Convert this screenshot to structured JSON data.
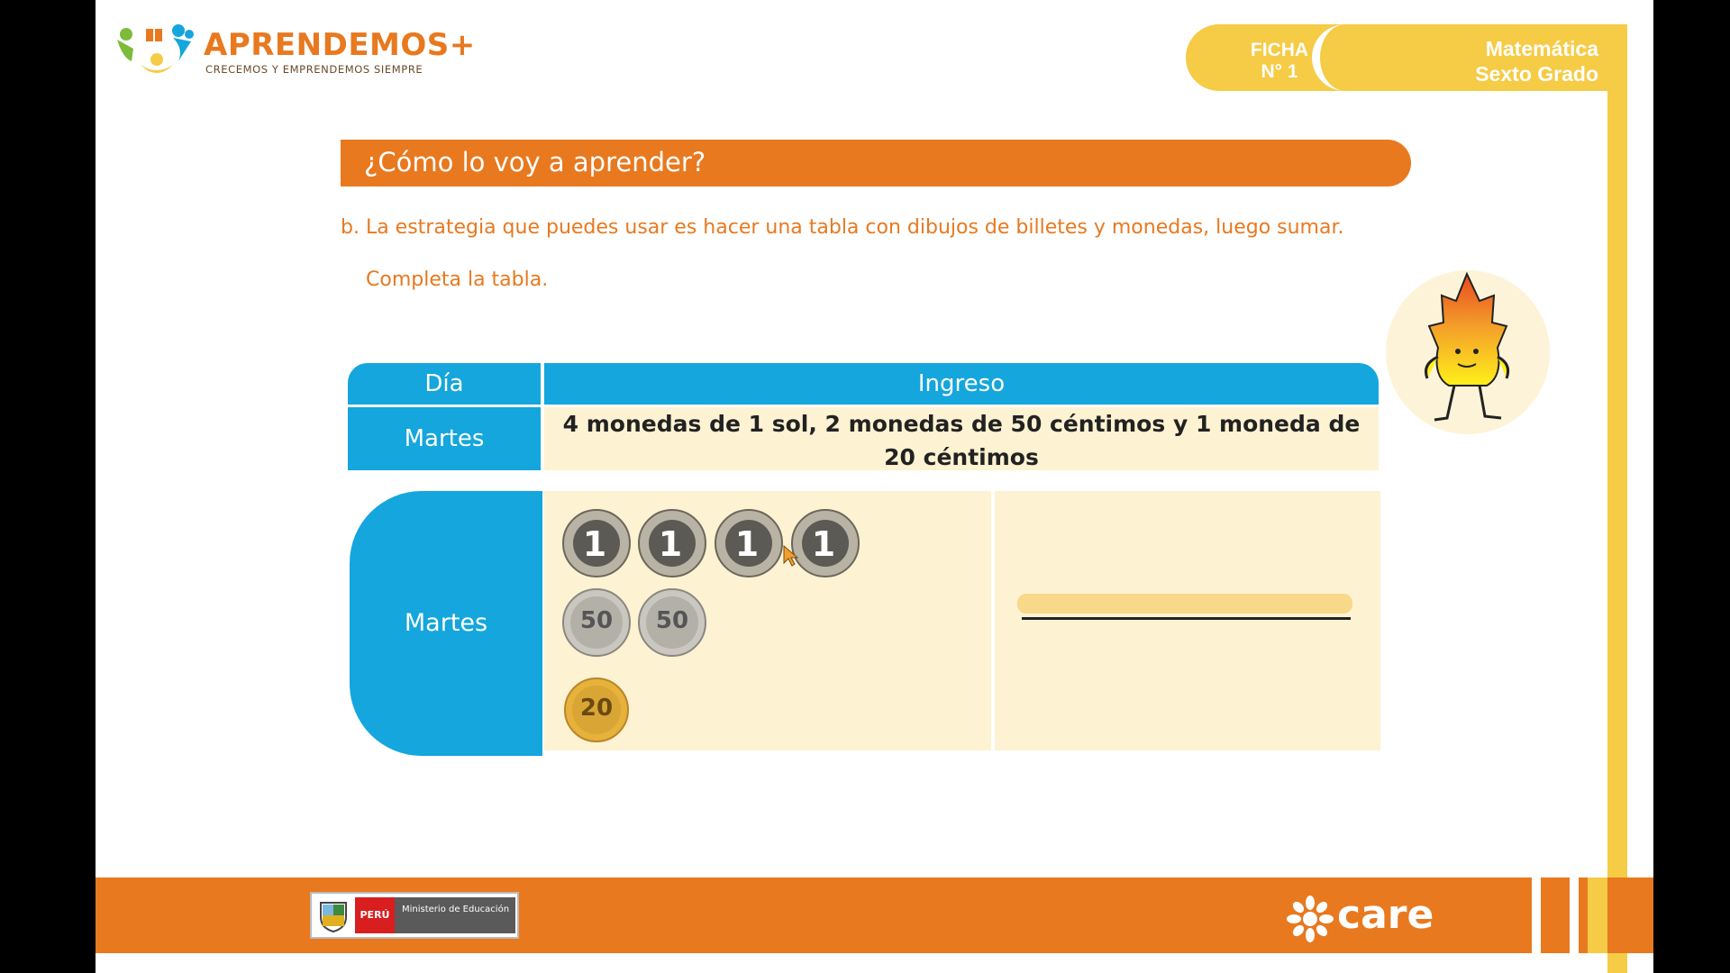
{
  "header": {
    "logo_title": "APRENDEMOS+",
    "logo_subtitle": "CRECEMOS Y EMPRENDEMOS SIEMPRE",
    "ficha_label": "FICHA",
    "ficha_number": "N° 1",
    "subject": "Matemática",
    "grade": "Sexto Grado"
  },
  "section": {
    "title": "¿Cómo lo voy a aprender?"
  },
  "instructions": {
    "strategy": "b. La estrategia que puedes usar es hacer una tabla con dibujos de billetes y monedas, luego sumar.",
    "complete": "Completa la tabla."
  },
  "table": {
    "header_day": "Día",
    "header_income": "Ingreso",
    "row1_day": "Martes",
    "row1_description": "4 monedas de 1 sol, 2 monedas de 50 céntimos y 1 moneda de 20 céntimos",
    "row2_day": "Martes",
    "coins": [
      {
        "value": "1",
        "unit": "SOL",
        "type": "sol"
      },
      {
        "value": "1",
        "unit": "SOL",
        "type": "sol"
      },
      {
        "value": "1",
        "unit": "SOL",
        "type": "sol"
      },
      {
        "value": "1",
        "unit": "SOL",
        "type": "sol"
      },
      {
        "value": "50",
        "unit": "CÉNTIMOS",
        "type": "silver"
      },
      {
        "value": "50",
        "unit": "CÉNTIMOS",
        "type": "silver"
      },
      {
        "value": "20",
        "unit": "CÉNTIMOS",
        "type": "gold"
      }
    ]
  },
  "footer": {
    "peru_label": "PERÚ",
    "ministry_label": "Ministerio de Educación",
    "care_label": "care"
  },
  "colors": {
    "orange": "#e8791f",
    "blue": "#14a6dc",
    "yellow": "#f6cb45",
    "cream": "#fdf2d2"
  }
}
